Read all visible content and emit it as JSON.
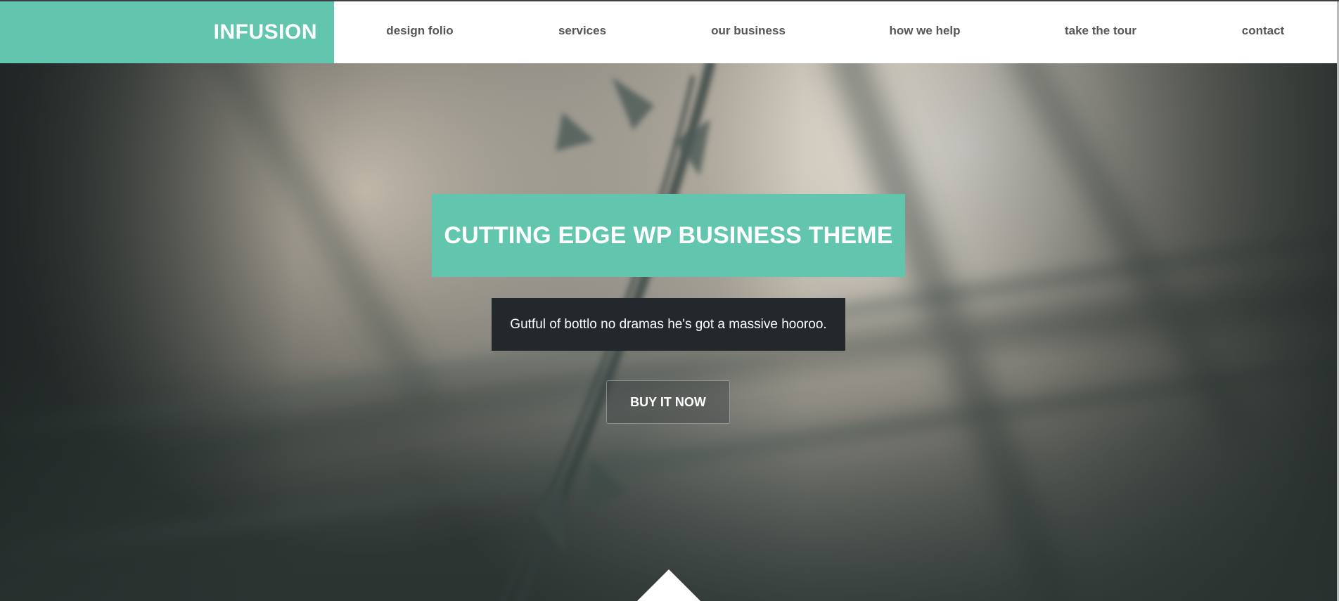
{
  "header": {
    "logo": "INFUSION",
    "nav": [
      {
        "label": "design folio"
      },
      {
        "label": "services"
      },
      {
        "label": "our business"
      },
      {
        "label": "how we help"
      },
      {
        "label": "take the tour"
      },
      {
        "label": "contact"
      }
    ]
  },
  "hero": {
    "headline": "CUTTING EDGE WP BUSINESS THEME",
    "tagline": "Gutful of bottlo no dramas he's got a massive hooroo.",
    "button_label": "BUY IT NOW",
    "background_image": "blurred barbed wire photo",
    "scroll_down_icon": "triangle-up-icon"
  },
  "colors": {
    "accent": "#62c6ae",
    "tagline_bg": "#22282b",
    "nav_text": "#545657",
    "white": "#ffffff"
  }
}
